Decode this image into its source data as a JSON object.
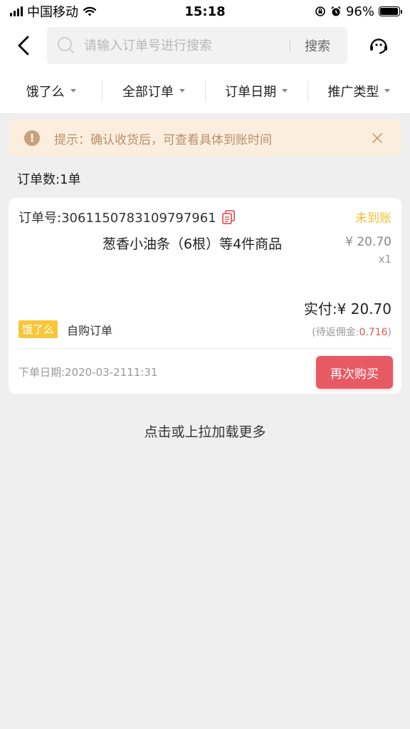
{
  "status_bar": {
    "carrier": "中国移动",
    "time": "15:18",
    "battery_percent": "96%",
    "battery_level": 0.96
  },
  "header": {
    "search_placeholder": "请输入订单号进行搜索",
    "search_button": "搜索"
  },
  "filters": [
    {
      "label": "饿了么"
    },
    {
      "label": "全部订单"
    },
    {
      "label": "订单日期"
    },
    {
      "label": "推广类型"
    }
  ],
  "tip": {
    "text": "提示：确认收货后，可查看具体到账时间"
  },
  "order_count": "订单数:1单",
  "order": {
    "order_no": "订单号:3061150783109797961",
    "status": "未到账",
    "product": "葱香小油条（6根）等4件商品",
    "price": "¥ 20.70",
    "qty": "x1",
    "paid": "实付:¥ 20.70",
    "platform_tag": "饿了么",
    "order_type": "自购订单",
    "commission_prefix": "(待返佣金:",
    "commission_value": "0.716",
    "commission_suffix": ")",
    "order_date": "下单日期:2020-03-2111:31",
    "rebuy_button": "再次购买"
  },
  "load_more": "点击或上拉加载更多",
  "colors": {
    "accent_red": "#e85a63",
    "status_yellow": "#f2c037",
    "tip_background": "#fbeede",
    "tip_text": "#b88f6c"
  },
  "icons": [
    "signal-icon",
    "wifi-icon",
    "lock-rotation-icon",
    "alarm-icon",
    "battery-icon",
    "back-arrow-icon",
    "search-icon",
    "customer-service-icon",
    "dropdown-caret-icon",
    "warning-icon",
    "close-icon",
    "copy-icon"
  ]
}
